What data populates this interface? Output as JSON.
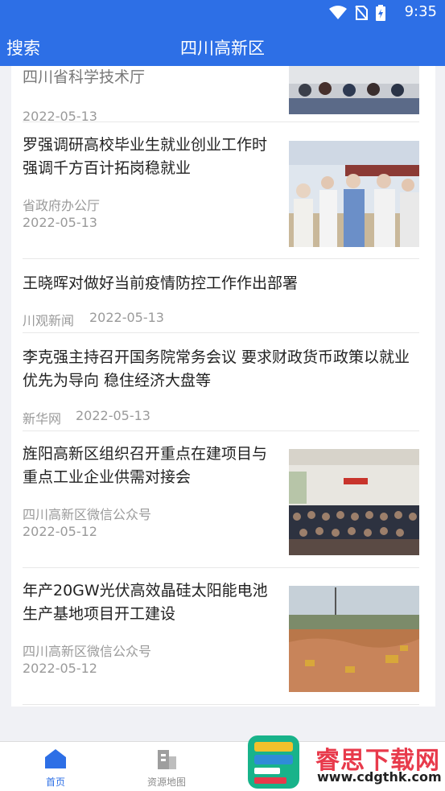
{
  "status_bar": {
    "time": "9:35"
  },
  "app_bar": {
    "search_label": "搜索",
    "title": "四川高新区"
  },
  "news": [
    {
      "title_line1": "",
      "title_line2": "四川省科学技术厅",
      "source": "",
      "date": "2022-05-13",
      "has_image": true
    },
    {
      "title_line1": "罗强调研高校毕业生就业创业工作时",
      "title_line2": "强调千方百计拓岗稳就业",
      "source": "省政府办公厅",
      "date": "2022-05-13",
      "has_image": true
    },
    {
      "title_line1": "王晓晖对做好当前疫情防控工作作出部署",
      "title_line2": "",
      "source": "川观新闻",
      "date": "2022-05-13",
      "has_image": false
    },
    {
      "title_line1": "李克强主持召开国务院常务会议 要求财政货币政策以就业",
      "title_line2": "优先为导向 稳住经济大盘等",
      "source": "新华网",
      "date": "2022-05-13",
      "has_image": false
    },
    {
      "title_line1": "旌阳高新区组织召开重点在建项目与",
      "title_line2": "重点工业企业供需对接会",
      "source": "四川高新区微信公众号",
      "date": "2022-05-12",
      "has_image": true
    },
    {
      "title_line1": "年产20GW光伏高效晶硅太阳能电池",
      "title_line2": "生产基地项目开工建设",
      "source": "四川高新区微信公众号",
      "date": "2022-05-12",
      "has_image": true
    }
  ],
  "tabs": [
    {
      "label": "首页",
      "icon": "home-icon",
      "active": true
    },
    {
      "label": "资源地图",
      "icon": "building-icon",
      "active": false
    }
  ],
  "watermark": {
    "title": "睿思下载网",
    "url": "www.cdgthk.com"
  },
  "colors": {
    "brand": "#2d6fe6",
    "watermark_red": "#e83a4b"
  }
}
